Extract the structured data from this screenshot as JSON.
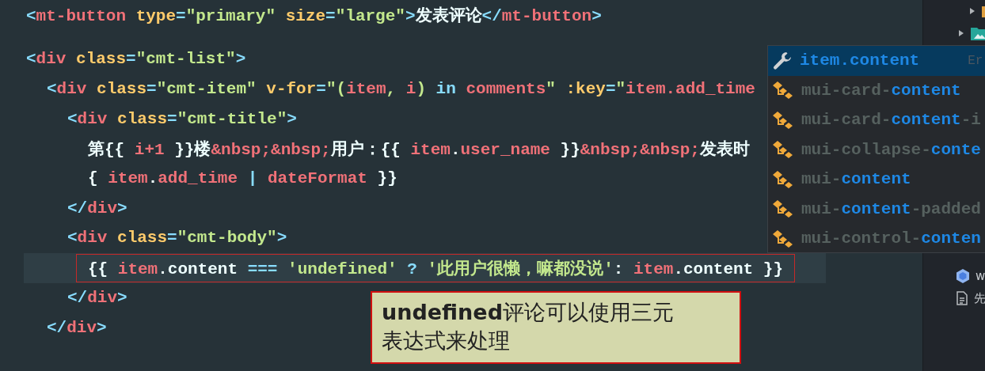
{
  "editor": {
    "lines": [
      {
        "tokens": [
          {
            "kind": "punct",
            "text": "<"
          },
          {
            "kind": "tag",
            "text": "mt-button"
          },
          {
            "kind": "attr",
            "text": " type"
          },
          {
            "kind": "punct",
            "text": "="
          },
          {
            "kind": "string",
            "text": "\"primary\""
          },
          {
            "kind": "attr",
            "text": " size"
          },
          {
            "kind": "punct",
            "text": "="
          },
          {
            "kind": "string",
            "text": "\"large\""
          },
          {
            "kind": "punct",
            "text": ">"
          },
          {
            "kind": "text",
            "text": "发表评论"
          },
          {
            "kind": "punct",
            "text": "</"
          },
          {
            "kind": "tag",
            "text": "mt-button"
          },
          {
            "kind": "punct",
            "text": ">"
          }
        ]
      },
      {
        "tokens": [
          {
            "kind": "punct",
            "text": "<"
          },
          {
            "kind": "tag",
            "text": "div"
          },
          {
            "kind": "attr",
            "text": " class"
          },
          {
            "kind": "punct",
            "text": "="
          },
          {
            "kind": "string",
            "text": "\"cmt-list\""
          },
          {
            "kind": "punct",
            "text": ">"
          }
        ],
        "children": [
          {
            "tokens": [
              {
                "kind": "punct",
                "text": "<"
              },
              {
                "kind": "tag",
                "text": "div"
              },
              {
                "kind": "attr",
                "text": " class"
              },
              {
                "kind": "punct",
                "text": "="
              },
              {
                "kind": "string",
                "text": "\"cmt-item\""
              },
              {
                "kind": "attr",
                "text": " v-for"
              },
              {
                "kind": "punct",
                "text": "="
              },
              {
                "kind": "string",
                "text": "\"("
              },
              {
                "kind": "var",
                "text": "item"
              },
              {
                "kind": "string",
                "text": ", "
              },
              {
                "kind": "var",
                "text": "i"
              },
              {
                "kind": "string",
                "text": ") "
              },
              {
                "kind": "keyword",
                "text": "in"
              },
              {
                "kind": "var",
                "text": " comments"
              },
              {
                "kind": "string",
                "text": "\""
              },
              {
                "kind": "attr",
                "text": " :key"
              },
              {
                "kind": "punct",
                "text": "="
              },
              {
                "kind": "string",
                "text": "\""
              },
              {
                "kind": "var",
                "text": "item.add_time"
              }
            ],
            "children": [
              {
                "tokens": [
                  {
                    "kind": "punct",
                    "text": "<"
                  },
                  {
                    "kind": "tag",
                    "text": "div"
                  },
                  {
                    "kind": "attr",
                    "text": " class"
                  },
                  {
                    "kind": "punct",
                    "text": "="
                  },
                  {
                    "kind": "string",
                    "text": "\"cmt-title\""
                  },
                  {
                    "kind": "punct",
                    "text": ">"
                  }
                ],
                "children": [
                  {
                    "tokens": [
                      {
                        "kind": "text",
                        "text": "第{{ "
                      },
                      {
                        "kind": "var",
                        "text": "i+1"
                      },
                      {
                        "kind": "text",
                        "text": " }}楼"
                      },
                      {
                        "kind": "entity",
                        "text": "&nbsp;&nbsp;"
                      },
                      {
                        "kind": "text",
                        "text": "用户：{{ "
                      },
                      {
                        "kind": "var",
                        "text": "item"
                      },
                      {
                        "kind": "text",
                        "text": "."
                      },
                      {
                        "kind": "var",
                        "text": "user_name"
                      },
                      {
                        "kind": "text",
                        "text": " }}"
                      },
                      {
                        "kind": "entity",
                        "text": "&nbsp;&nbsp;"
                      },
                      {
                        "kind": "text",
                        "text": "发表时"
                      }
                    ]
                  },
                  {
                    "tokens": [
                      {
                        "kind": "text",
                        "text": "{ "
                      },
                      {
                        "kind": "var",
                        "text": "item"
                      },
                      {
                        "kind": "text",
                        "text": "."
                      },
                      {
                        "kind": "var",
                        "text": "add_time"
                      },
                      {
                        "kind": "keyword",
                        "text": " | "
                      },
                      {
                        "kind": "var",
                        "text": "dateFormat"
                      },
                      {
                        "kind": "text",
                        "text": " }}"
                      }
                    ]
                  }
                ]
              },
              {
                "tokens": [
                  {
                    "kind": "punct",
                    "text": "</"
                  },
                  {
                    "kind": "tag",
                    "text": "div"
                  },
                  {
                    "kind": "punct",
                    "text": ">"
                  }
                ]
              },
              {
                "tokens": [
                  {
                    "kind": "punct",
                    "text": "<"
                  },
                  {
                    "kind": "tag",
                    "text": "div"
                  },
                  {
                    "kind": "attr",
                    "text": " class"
                  },
                  {
                    "kind": "punct",
                    "text": "="
                  },
                  {
                    "kind": "string",
                    "text": "\"cmt-body\""
                  },
                  {
                    "kind": "punct",
                    "text": ">"
                  }
                ],
                "children": [
                  {
                    "current": true,
                    "annotated": true,
                    "tokens": [
                      {
                        "kind": "text",
                        "text": "{{ "
                      },
                      {
                        "kind": "var",
                        "text": "item"
                      },
                      {
                        "kind": "text",
                        "text": ".content "
                      },
                      {
                        "kind": "keyword",
                        "text": "==="
                      },
                      {
                        "kind": "string",
                        "text": " 'undefined'"
                      },
                      {
                        "kind": "keyword",
                        "text": " ?"
                      },
                      {
                        "kind": "string",
                        "text": " '此用户很懒，嘛都没说'"
                      },
                      {
                        "kind": "text",
                        "text": ": "
                      },
                      {
                        "kind": "var",
                        "text": "item"
                      },
                      {
                        "kind": "text",
                        "text": ".content }}"
                      }
                    ]
                  }
                ]
              },
              {
                "tokens": [
                  {
                    "kind": "punct",
                    "text": "</"
                  },
                  {
                    "kind": "tag",
                    "text": "div"
                  },
                  {
                    "kind": "punct",
                    "text": ">"
                  }
                ]
              }
            ]
          },
          {
            "tokens": [
              {
                "kind": "punct",
                "text": "</"
              },
              {
                "kind": "tag",
                "text": "div"
              },
              {
                "kind": "punct",
                "text": ">"
              }
            ]
          }
        ]
      }
    ]
  },
  "popup": {
    "items": [
      {
        "kind": "wrench",
        "selected": true,
        "parts": [
          {
            "text": "item.content",
            "match": true
          }
        ],
        "hint": "Er"
      },
      {
        "kind": "tag",
        "selected": false,
        "parts": [
          {
            "text": "mui-card-",
            "match": false
          },
          {
            "text": "content",
            "match": true
          }
        ]
      },
      {
        "kind": "tag",
        "selected": false,
        "parts": [
          {
            "text": "mui-card-",
            "match": false
          },
          {
            "text": "content",
            "match": true
          },
          {
            "text": "-i",
            "match": false
          }
        ]
      },
      {
        "kind": "tag",
        "selected": false,
        "parts": [
          {
            "text": "mui-collapse-",
            "match": false
          },
          {
            "text": "conte",
            "match": true
          }
        ]
      },
      {
        "kind": "tag",
        "selected": false,
        "parts": [
          {
            "text": "mui-",
            "match": false
          },
          {
            "text": "content",
            "match": true
          }
        ]
      },
      {
        "kind": "tag",
        "selected": false,
        "parts": [
          {
            "text": "mui-",
            "match": false
          },
          {
            "text": "content",
            "match": true
          },
          {
            "text": "-padded",
            "match": false
          }
        ]
      },
      {
        "kind": "tag",
        "selected": false,
        "parts": [
          {
            "text": "mui-control-",
            "match": false
          },
          {
            "text": "conten",
            "match": true
          }
        ]
      }
    ]
  },
  "sidebar": {
    "top_items": [
      {
        "kind": "folder",
        "expanded": false,
        "color": "#e0a040"
      },
      {
        "kind": "image-folder",
        "expanded": false,
        "color": "#26a69a"
      }
    ],
    "bottom_items": [
      {
        "kind": "component",
        "label": "w"
      },
      {
        "kind": "file",
        "label": "先"
      }
    ]
  },
  "note": {
    "text": "**undefined**评论可以使用三元表达式来处理"
  }
}
